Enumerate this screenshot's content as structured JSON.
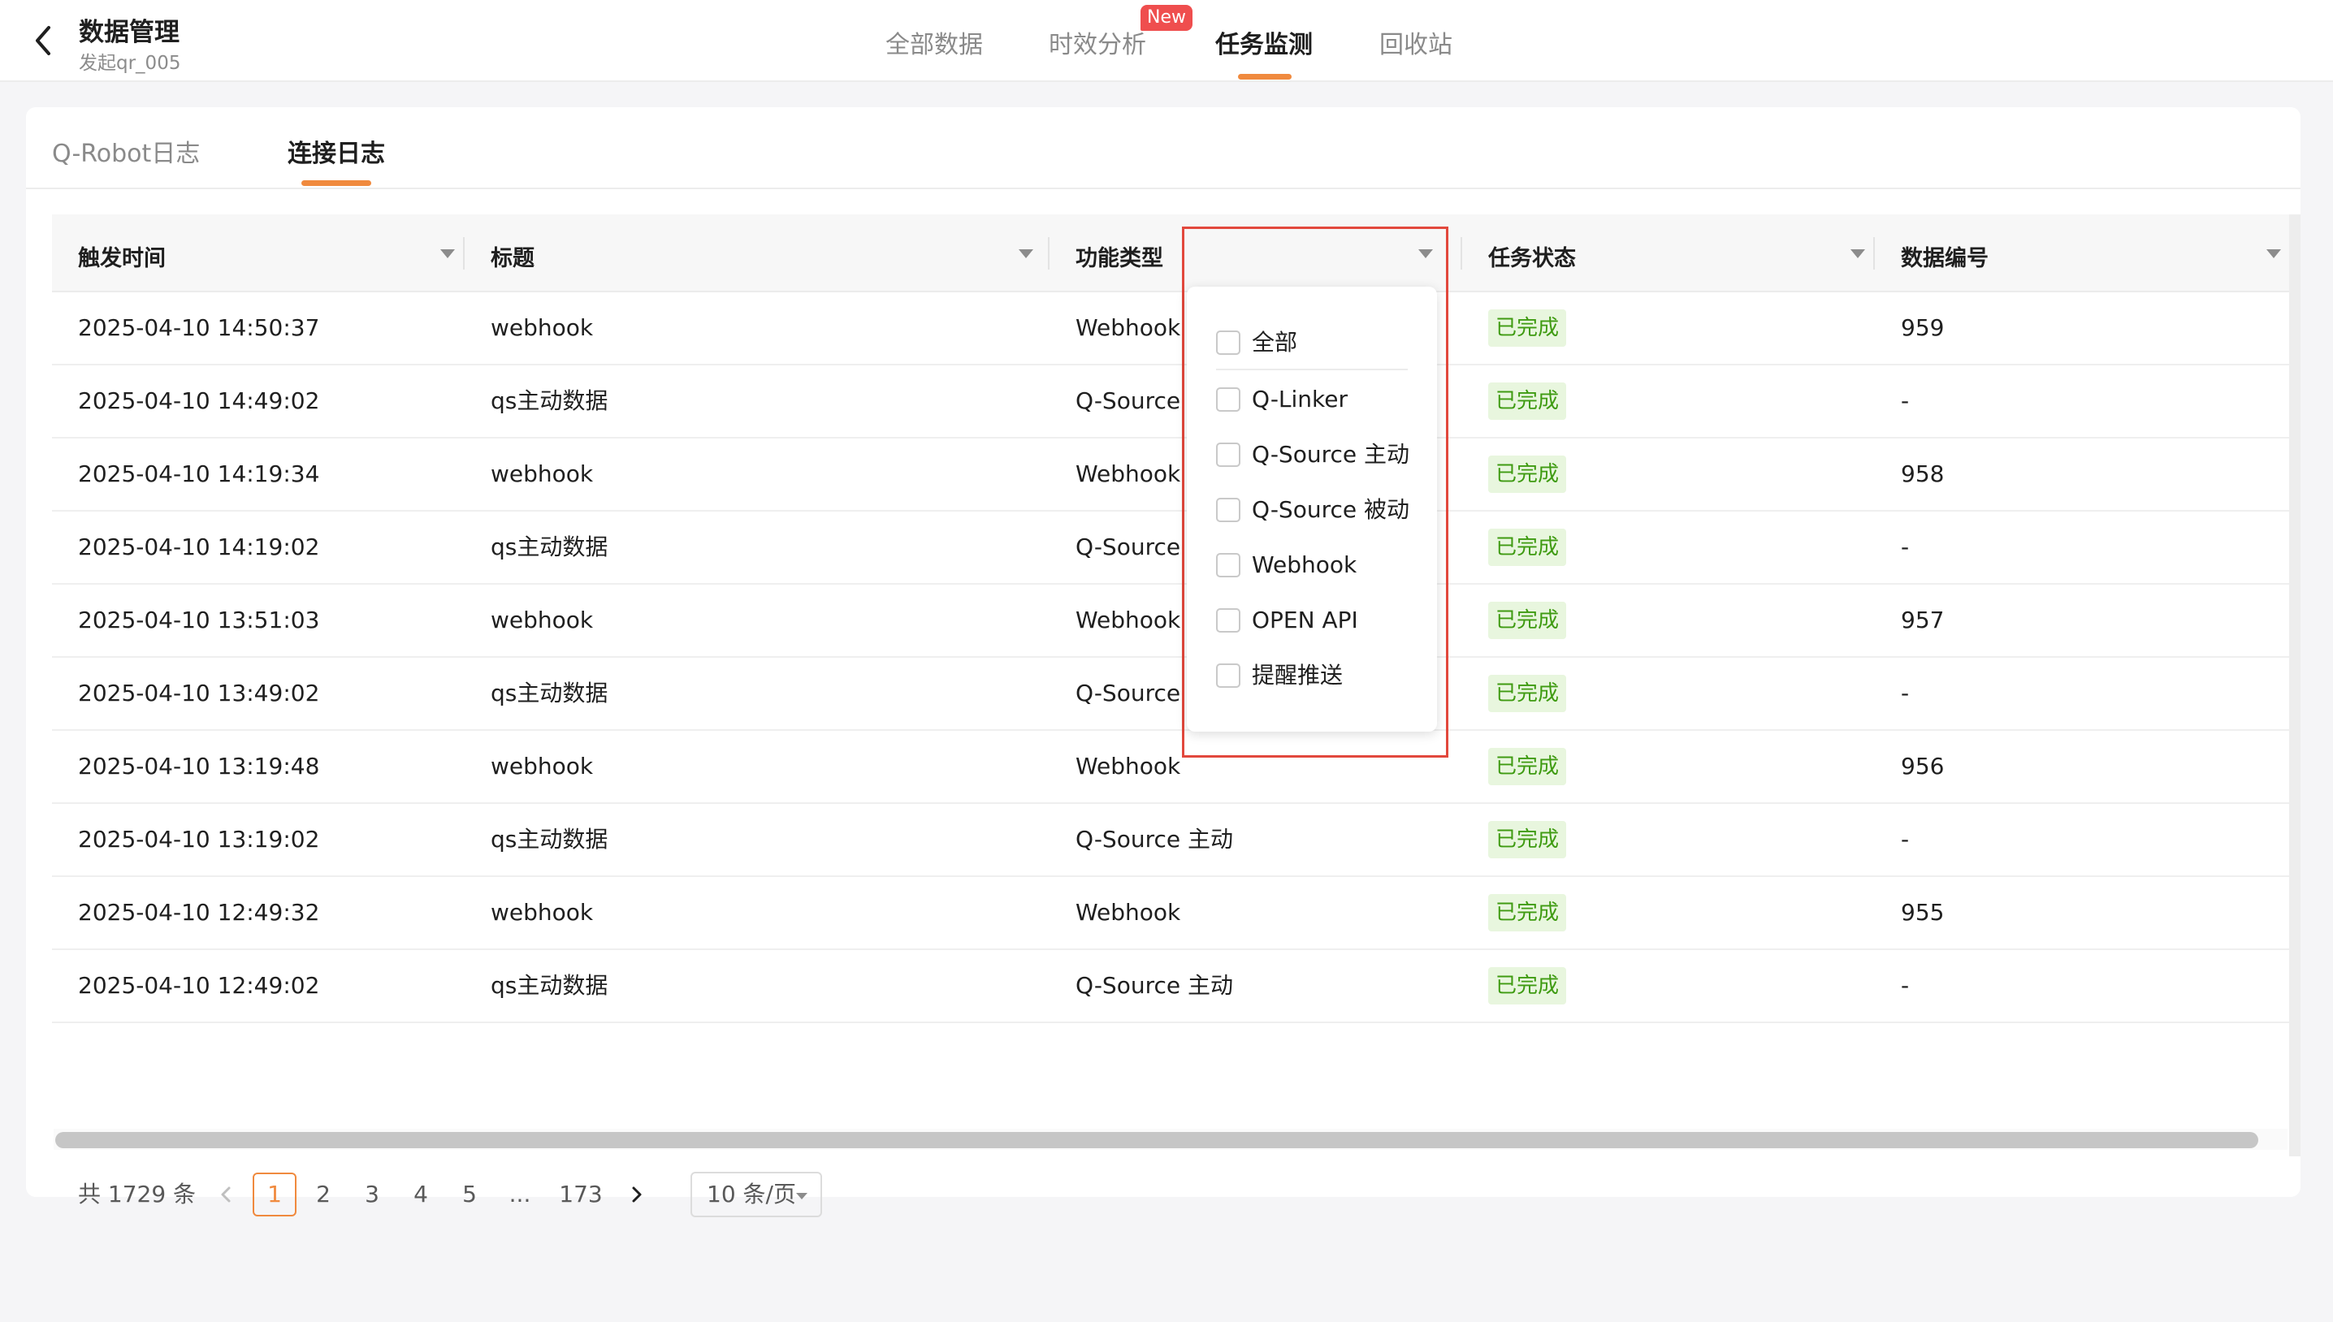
{
  "header": {
    "title": "数据管理",
    "subtitle": "发起qr_005",
    "tabs": [
      {
        "label": "全部数据",
        "active": false
      },
      {
        "label": "时效分析",
        "active": false,
        "badge": "New"
      },
      {
        "label": "任务监测",
        "active": true
      },
      {
        "label": "回收站",
        "active": false
      }
    ]
  },
  "subtabs": [
    {
      "label": "Q-Robot日志",
      "active": false
    },
    {
      "label": "连接日志",
      "active": true
    }
  ],
  "table": {
    "columns": [
      "触发时间",
      "标题",
      "功能类型",
      "",
      "任务状态",
      "数据编号"
    ],
    "rows": [
      {
        "time": "2025-04-10 14:50:37",
        "title": "webhook",
        "type": "Webhook",
        "status": "已完成",
        "number": "959"
      },
      {
        "time": "2025-04-10 14:49:02",
        "title": "qs主动数据",
        "type": "Q-Source 主动",
        "status": "已完成",
        "number": "-"
      },
      {
        "time": "2025-04-10 14:19:34",
        "title": "webhook",
        "type": "Webhook",
        "status": "已完成",
        "number": "958"
      },
      {
        "time": "2025-04-10 14:19:02",
        "title": "qs主动数据",
        "type": "Q-Source 主动",
        "status": "已完成",
        "number": "-"
      },
      {
        "time": "2025-04-10 13:51:03",
        "title": "webhook",
        "type": "Webhook",
        "status": "已完成",
        "number": "957"
      },
      {
        "time": "2025-04-10 13:49:02",
        "title": "qs主动数据",
        "type": "Q-Source 主动",
        "status": "已完成",
        "number": "-"
      },
      {
        "time": "2025-04-10 13:19:48",
        "title": "webhook",
        "type": "Webhook",
        "status": "已完成",
        "number": "956"
      },
      {
        "time": "2025-04-10 13:19:02",
        "title": "qs主动数据",
        "type": "Q-Source 主动",
        "status": "已完成",
        "number": "-"
      },
      {
        "time": "2025-04-10 12:49:32",
        "title": "webhook",
        "type": "Webhook",
        "status": "已完成",
        "number": "955"
      },
      {
        "time": "2025-04-10 12:49:02",
        "title": "qs主动数据",
        "type": "Q-Source 主动",
        "status": "已完成",
        "number": "-"
      }
    ]
  },
  "filter_dropdown": {
    "options": [
      {
        "label": "全部",
        "checked": false
      },
      {
        "label": "Q-Linker",
        "checked": false
      },
      {
        "label": "Q-Source 主动",
        "checked": false
      },
      {
        "label": "Q-Source 被动",
        "checked": false
      },
      {
        "label": "Webhook",
        "checked": false
      },
      {
        "label": "OPEN API",
        "checked": false
      },
      {
        "label": "提醒推送",
        "checked": false
      }
    ]
  },
  "pagination": {
    "total_label": "共 1729 条",
    "current_page": "1",
    "pages": [
      "1",
      "2",
      "3",
      "4",
      "5"
    ],
    "ellipsis": "...",
    "last_page": "173",
    "page_size_label": "10 条/页"
  },
  "colors": {
    "accent": "#f08a3e",
    "badge_red": "#ef4e4e",
    "status_bg": "#e8f6de",
    "status_text": "#3f9b12",
    "highlight_border": "#e2483d"
  },
  "icons": [
    "back-arrow-icon",
    "dropdown-caret-icon",
    "chevron-left-icon",
    "chevron-right-icon",
    "checkbox-icon"
  ]
}
